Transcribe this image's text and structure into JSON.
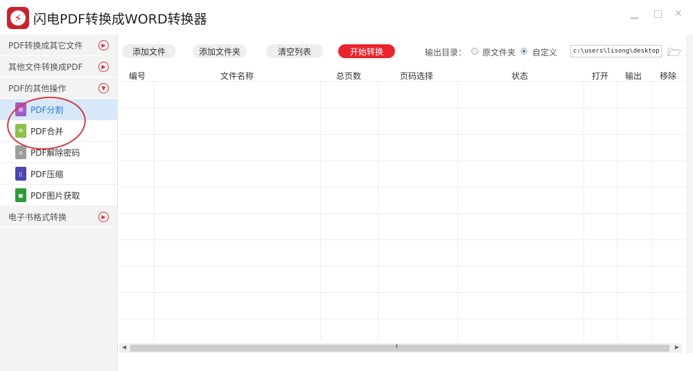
{
  "app": {
    "title": "闪电PDF转换成WORD转换器",
    "minimize": "▁",
    "maximize": "□",
    "close": "✕"
  },
  "sidebar": {
    "sections": [
      {
        "label": "PDF转换成其它文件"
      },
      {
        "label": "其他文件转换成PDF"
      },
      {
        "label": "PDF的其他操作",
        "expanded": true
      },
      {
        "label": "电子书格式转换"
      }
    ],
    "items": [
      {
        "label": "PDF分割",
        "color": "#a05cc8",
        "active": true
      },
      {
        "label": "PDF合并",
        "color": "#8dc04c"
      },
      {
        "label": "PDF解除密码",
        "color": "#9e9e9e"
      },
      {
        "label": "PDF压缩",
        "color": "#4a47b0"
      },
      {
        "label": "PDF图片获取",
        "color": "#2f9a3c"
      }
    ]
  },
  "toolbar": {
    "add_file": "添加文件",
    "add_folder": "添加文件夹",
    "clear_list": "清空列表",
    "start": "开始转换",
    "output_label": "输出目录：",
    "opt_original": "原文件夹",
    "opt_custom": "自定义",
    "selected": "自定义",
    "path": "c:\\users\\lisong\\desktop"
  },
  "table": {
    "columns": [
      "编号",
      "文件名称",
      "总页数",
      "页码选择",
      "状态",
      "打开",
      "输出",
      "移除"
    ]
  },
  "scroll": {
    "grip": "⦀"
  }
}
